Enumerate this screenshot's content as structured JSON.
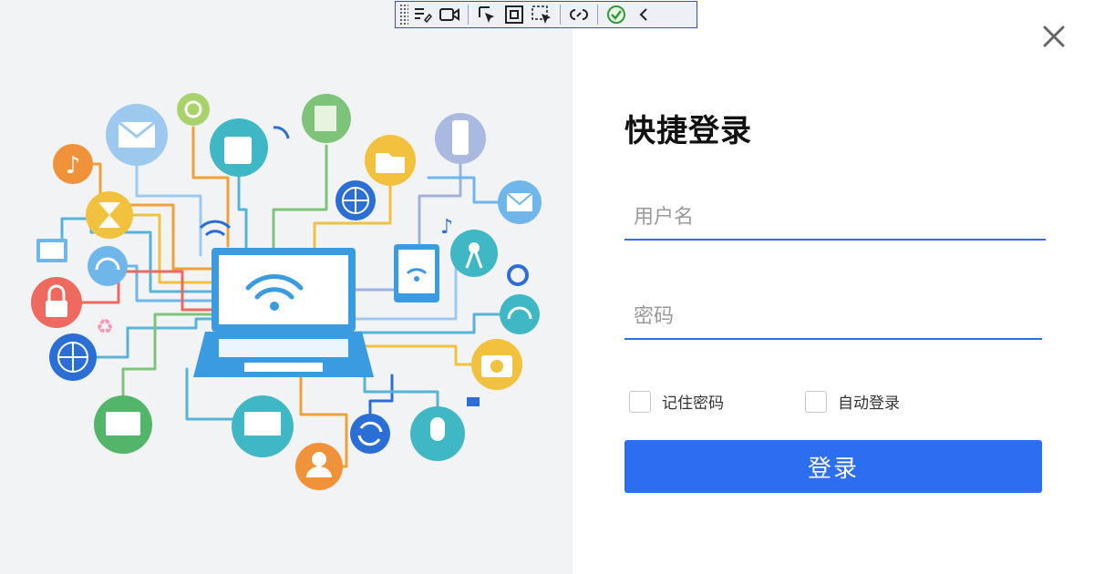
{
  "window": {
    "close_icon": "close-icon"
  },
  "toolbar": {
    "tools": [
      "edit-list-icon",
      "video-icon",
      "pointer-select-icon",
      "frame-icon",
      "region-select-icon",
      "link-icon",
      "check-icon",
      "collapse-chevron-icon"
    ]
  },
  "login": {
    "title": "快捷登录",
    "username_placeholder": "用户名",
    "password_placeholder": "密码",
    "remember_password_label": "记住密码",
    "auto_login_label": "自动登录",
    "login_button_label": "登录"
  },
  "illustration": {
    "icons": [
      "laptop-wifi-icon",
      "mail-icon",
      "power-icon",
      "camera-phone-icon",
      "document-icon",
      "mobile-phone-icon",
      "music-note-icon",
      "hourglass-icon",
      "folder-icon",
      "globe-icon",
      "monitor-icon",
      "headset-chat-icon",
      "lock-icon",
      "recycle-icon",
      "tablet-wifi-icon",
      "antenna-icon",
      "gear-icon",
      "headphones-icon",
      "camera-icon",
      "tv-icon",
      "laptop-icon",
      "refresh-icon",
      "microphone-icon",
      "user-icon"
    ]
  }
}
